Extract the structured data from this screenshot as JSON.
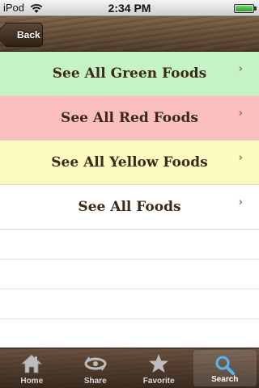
{
  "status_bar": {
    "carrier": "iPod",
    "time": "2:34 PM",
    "wifi_icon": "wifi-icon",
    "battery_icon": "battery-icon"
  },
  "nav": {
    "back_label": "Back"
  },
  "list": {
    "items": [
      {
        "label": "See All Green Foods",
        "bg": "#c6f3c6"
      },
      {
        "label": "See All Red Foods",
        "bg": "#fcbfbf"
      },
      {
        "label": "See All Yellow Foods",
        "bg": "#fdfbbf"
      },
      {
        "label": "See All Foods",
        "bg": "#ffffff"
      }
    ],
    "chevron": "›"
  },
  "tab_bar": {
    "tabs": [
      {
        "label": "Home",
        "icon": "home-icon"
      },
      {
        "label": "Share",
        "icon": "share-icon"
      },
      {
        "label": "Favorite",
        "icon": "star-icon"
      },
      {
        "label": "Search",
        "icon": "search-icon",
        "active": true
      }
    ]
  }
}
